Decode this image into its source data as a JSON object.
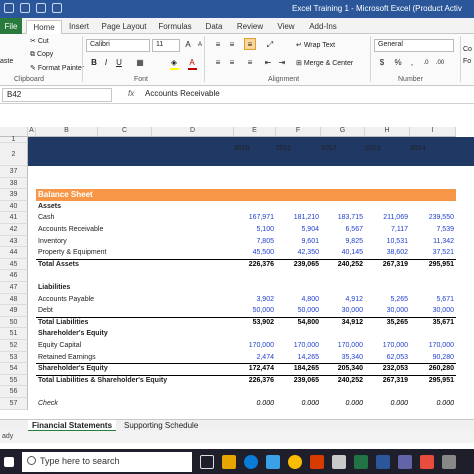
{
  "window": {
    "title": "Excel Training 1 - Microsoft Excel (Product Activ"
  },
  "tabs": [
    "File",
    "Home",
    "Insert",
    "Page Layout",
    "Formulas",
    "Data",
    "Review",
    "View",
    "Add-Ins"
  ],
  "ribbon": {
    "clipboard": {
      "paste": "aste",
      "cut": "Cut",
      "copy": "Copy",
      "format_painter": "Format Painter",
      "group": "Clipboard"
    },
    "font": {
      "name": "Calibri",
      "size": "11",
      "group": "Font"
    },
    "alignment": {
      "wrap_text": "Wrap Text",
      "merge_center": "Merge & Center",
      "group": "Alignment"
    },
    "number": {
      "format": "General",
      "currency": "$",
      "percent": "%",
      "comma": ",",
      "group": "Number"
    },
    "styles_clip": {
      "co1": "Co",
      "co2": "Fo"
    }
  },
  "formula_bar": {
    "name_box": "B42",
    "fx": "fx",
    "content": "Accounts Receivable"
  },
  "columns": [
    "A",
    "B",
    "C",
    "D",
    "E",
    "F",
    "G",
    "H",
    "I"
  ],
  "years": [
    "2010",
    "2011",
    "2012",
    "2013",
    "2014"
  ],
  "rows": [
    {
      "n": "1"
    },
    {
      "n": "2"
    },
    {
      "n": "37"
    },
    {
      "n": "38"
    },
    {
      "n": "39",
      "label": "Balance Sheet",
      "type": "section"
    },
    {
      "n": "40",
      "label": "Assets",
      "type": "header"
    },
    {
      "n": "41",
      "label": "Cash",
      "values": [
        "167,971",
        "181,210",
        "183,715",
        "211,069",
        "239,550"
      ]
    },
    {
      "n": "42",
      "label": "Accounts Receivable",
      "values": [
        "5,100",
        "5,904",
        "6,567",
        "7,117",
        "7,539"
      ]
    },
    {
      "n": "43",
      "label": "Inventory",
      "values": [
        "7,805",
        "9,601",
        "9,825",
        "10,531",
        "11,342"
      ]
    },
    {
      "n": "44",
      "label": "Property & Equipment",
      "values": [
        "45,500",
        "42,350",
        "40,145",
        "38,602",
        "37,521"
      ]
    },
    {
      "n": "45",
      "label": "Total Assets",
      "type": "total",
      "values": [
        "226,376",
        "239,065",
        "240,252",
        "267,319",
        "295,951"
      ]
    },
    {
      "n": "46"
    },
    {
      "n": "47",
      "label": "Liabilities",
      "type": "header"
    },
    {
      "n": "48",
      "label": "Accounts Payable",
      "values": [
        "3,902",
        "4,800",
        "4,912",
        "5,265",
        "5,671"
      ]
    },
    {
      "n": "49",
      "label": "Debt",
      "values": [
        "50,000",
        "50,000",
        "30,000",
        "30,000",
        "30,000"
      ]
    },
    {
      "n": "50",
      "label": "Total Liabilities",
      "type": "total",
      "values": [
        "53,902",
        "54,800",
        "34,912",
        "35,265",
        "35,671"
      ]
    },
    {
      "n": "51",
      "label": "Shareholder's Equity",
      "type": "header"
    },
    {
      "n": "52",
      "label": "Equity Capital",
      "values": [
        "170,000",
        "170,000",
        "170,000",
        "170,000",
        "170,000"
      ]
    },
    {
      "n": "53",
      "label": "Retained Earnings",
      "values": [
        "2,474",
        "14,265",
        "35,340",
        "62,053",
        "90,280"
      ]
    },
    {
      "n": "54",
      "label": "Shareholder's Equity",
      "type": "total",
      "values": [
        "172,474",
        "184,265",
        "205,340",
        "232,053",
        "260,280"
      ]
    },
    {
      "n": "55",
      "label": "Total Liabilities & Shareholder's Equity",
      "type": "total",
      "values": [
        "226,376",
        "239,065",
        "240,252",
        "267,319",
        "295,951"
      ]
    },
    {
      "n": "56"
    },
    {
      "n": "57",
      "label": "Check",
      "type": "check",
      "values": [
        "0.000",
        "0.000",
        "0.000",
        "0.000",
        "0.000"
      ]
    }
  ],
  "sheets": [
    "Financial Statements",
    "Supporting Schedule"
  ],
  "status": "ady",
  "taskbar": {
    "search_placeholder": "Type here to search"
  },
  "colors": {
    "title_bar": "#2b579a",
    "file_tab": "#2a7a3b",
    "year_band": "#1f3864",
    "section_band": "#f79646",
    "input_blue": "#1f3fd0"
  }
}
